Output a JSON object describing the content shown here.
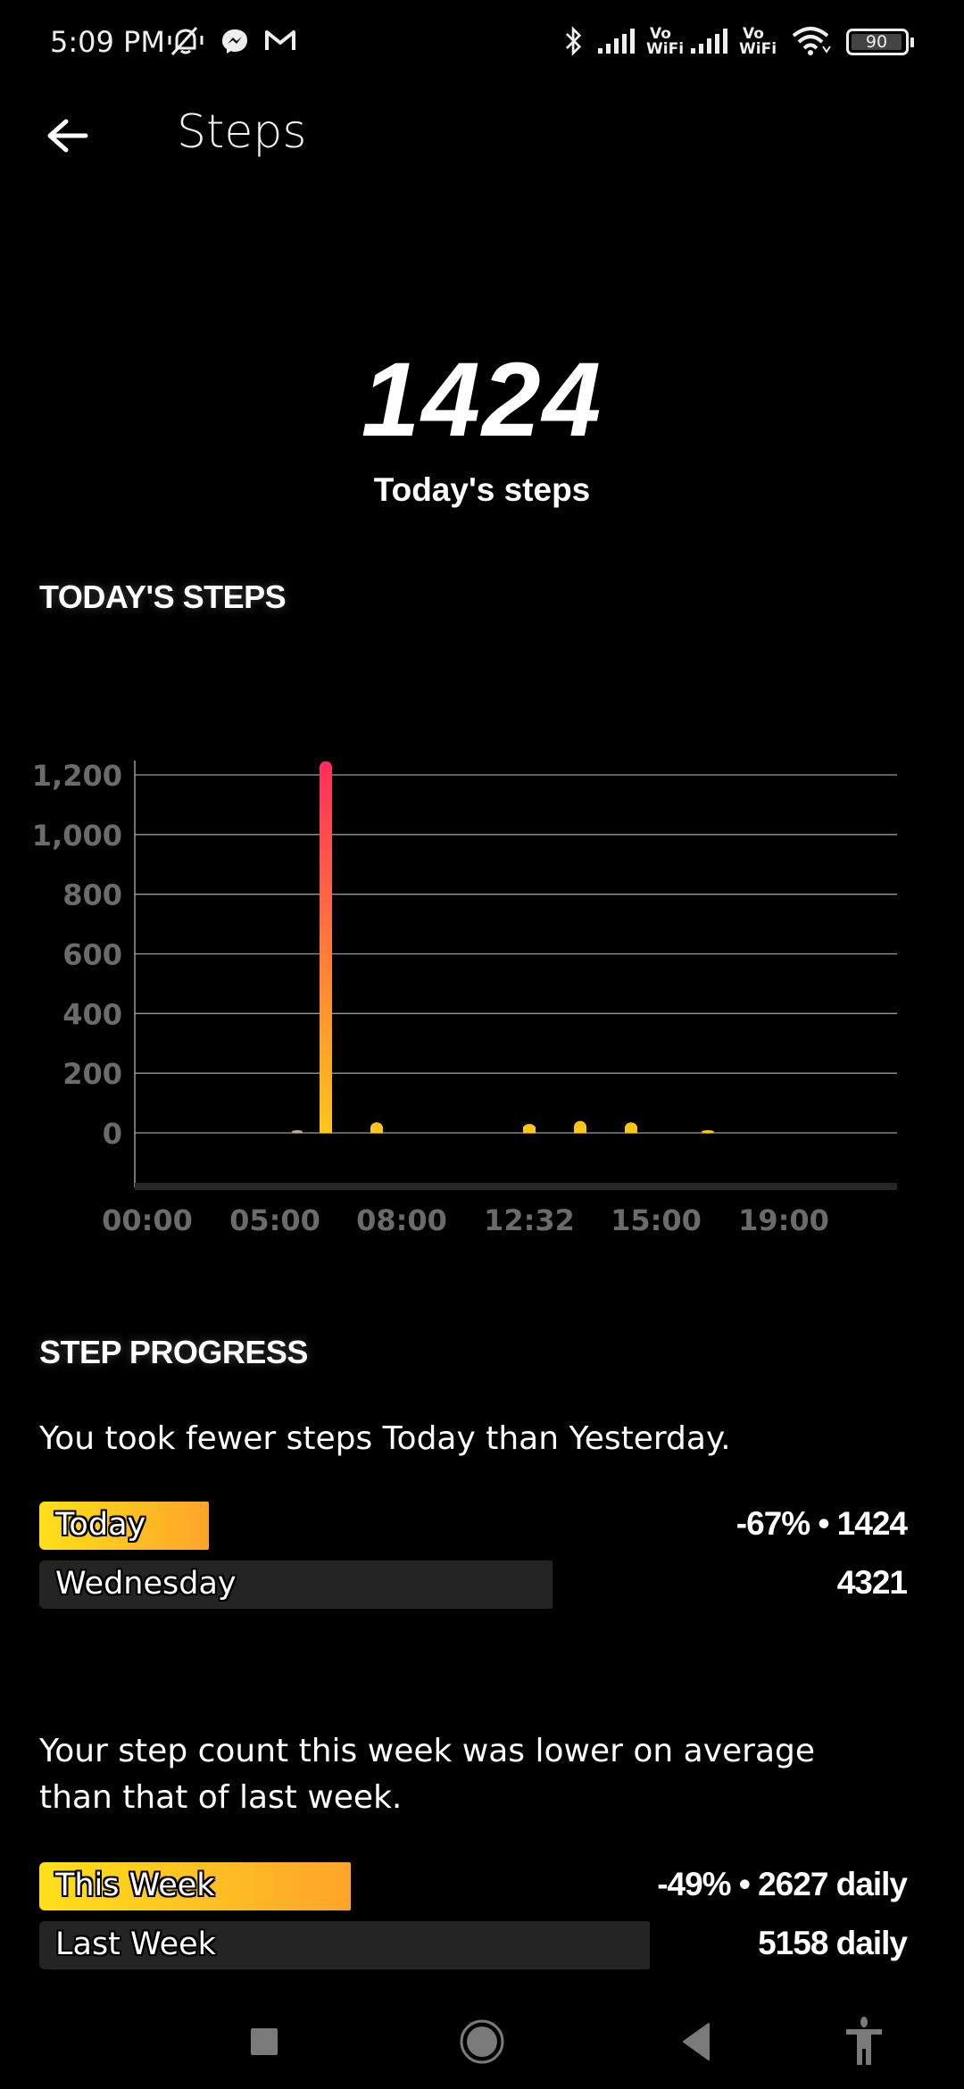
{
  "status_bar": {
    "time": "5:09 PM",
    "notification_icons": [
      "vibrate-off-icon",
      "messenger-icon",
      "gmail-icon"
    ],
    "system_icons": [
      "bluetooth-icon",
      "signal-icon",
      "vowifi-icon",
      "signal-icon",
      "vowifi-icon",
      "wifi-icon",
      "battery-icon"
    ],
    "vowifi_top": "Vo",
    "vowifi_bottom": "WiFi",
    "battery_level": "90"
  },
  "app_bar": {
    "back_icon": "arrow-left-icon",
    "title": "Steps"
  },
  "hero": {
    "value": "1424",
    "label": "Today's steps"
  },
  "sections": {
    "todays_steps_title": "TODAY'S STEPS",
    "step_progress_title": "STEP PROGRESS"
  },
  "chart_data": {
    "type": "bar",
    "title": "TODAY'S STEPS",
    "xlabel": "",
    "ylabel": "",
    "ylim": [
      0,
      1200
    ],
    "yticks": [
      0,
      200,
      400,
      600,
      800,
      1000,
      1200
    ],
    "ytick_labels": [
      "0",
      "200",
      "400",
      "600",
      "800",
      "1,000",
      "1,200"
    ],
    "xlim_hours": [
      0,
      24
    ],
    "xticks_hours": [
      0,
      5,
      8,
      12.53,
      15,
      19
    ],
    "xtick_labels": [
      "00:00",
      "05:00",
      "08:00",
      "12:32",
      "15:00",
      "19:00"
    ],
    "grid": true,
    "legend": "none",
    "bar_gradient": {
      "low": "#FFC61A",
      "high": "#FF2D5C"
    },
    "x_hours": [
      6.3,
      7.0,
      8.5,
      13.0,
      14.5,
      16.0,
      18.3
    ],
    "values": [
      2,
      1246,
      35,
      30,
      40,
      35,
      8
    ]
  },
  "comparisons": [
    {
      "message": "You took fewer steps Today than Yesterday.",
      "rows": [
        {
          "label": "Today",
          "value_text": "-67% • 1424",
          "fill_fraction": 0.33,
          "style": "highlight"
        },
        {
          "label": "Wednesday",
          "value_text": "4321",
          "fill_fraction": 1.0,
          "style": "muted"
        }
      ]
    },
    {
      "message": "Your step count this week was lower on average than that of last week.",
      "rows": [
        {
          "label": "This Week",
          "value_text": "-49% • 2627 daily",
          "fill_fraction": 0.51,
          "style": "highlight"
        },
        {
          "label": "Last Week",
          "value_text": "5158 daily",
          "fill_fraction": 1.0,
          "style": "muted"
        }
      ]
    }
  ],
  "colors": {
    "background": "#000000",
    "highlight_start": "#FFE01A",
    "highlight_end": "#FFA42A",
    "muted_bar": "#242424",
    "grid": "#9a9a9a",
    "tick_label": "#6b6b6b"
  },
  "nav_bar": {
    "buttons": [
      "recents-icon",
      "home-icon",
      "back-icon",
      "accessibility-icon"
    ]
  }
}
